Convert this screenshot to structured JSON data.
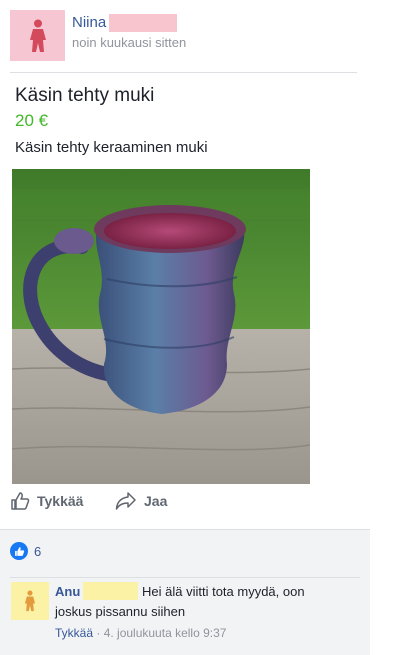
{
  "post": {
    "author": "Niina",
    "time": "noin kuukausi sitten"
  },
  "listing": {
    "title": "Käsin tehty muki",
    "price": "20 €",
    "description": "Käsin tehty keraaminen muki"
  },
  "actions": {
    "like_label": "Tykkää",
    "share_label": "Jaa"
  },
  "reactions": {
    "count": "6"
  },
  "comment": {
    "author": "Anu",
    "text_line1": "Hei älä viitti tota myydä, oon",
    "text_line2": "joskus pissannu siihen",
    "like_label": "Tykkää",
    "date": "· 4. joulukuuta kello 9:37"
  },
  "colors": {
    "link": "#365899",
    "price": "#42b72a",
    "like_badge": "#1877f2",
    "poster_avatar": "#f6c7d2",
    "commenter_avatar": "#fbf2a5"
  },
  "icons": [
    "person-icon",
    "thumbs-up-icon",
    "share-arrow-icon",
    "like-reaction-icon"
  ]
}
